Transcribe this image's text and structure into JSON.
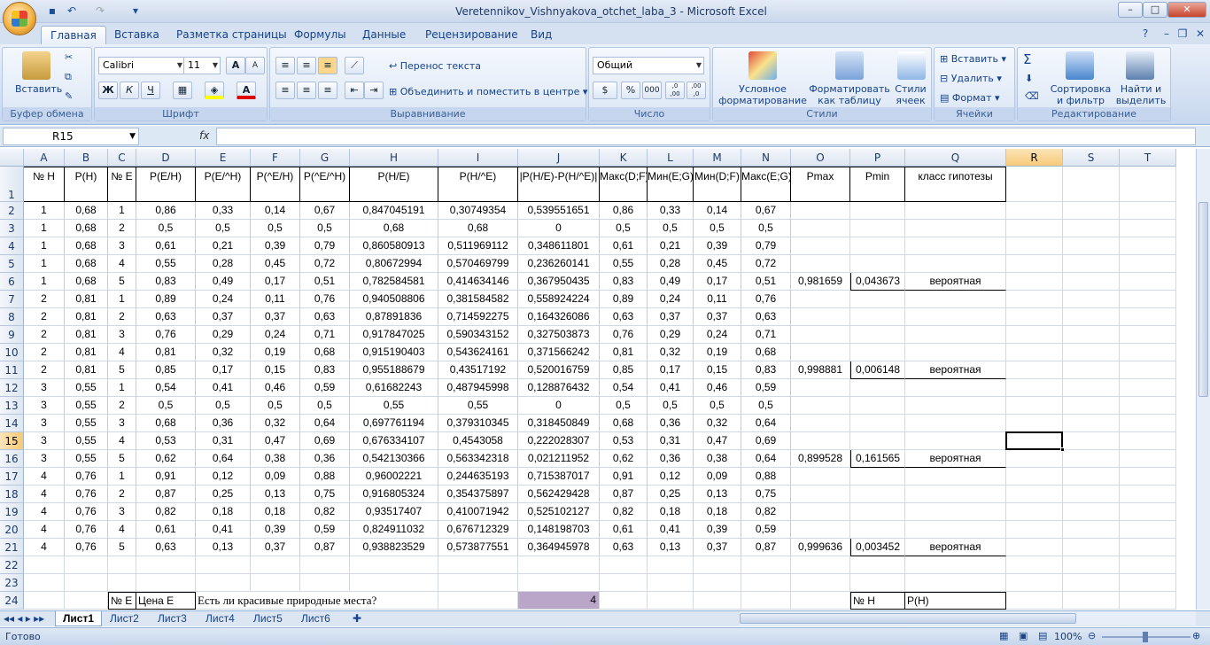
{
  "window": {
    "title": "Veretennikov_Vishnyakova_otchet_laba_3 - Microsoft Excel"
  },
  "tabs": [
    "Главная",
    "Вставка",
    "Разметка страницы",
    "Формулы",
    "Данные",
    "Рецензирование",
    "Вид"
  ],
  "ribbon": {
    "clipboard": {
      "label": "Буфер обмена",
      "paste": "Вставить"
    },
    "font": {
      "label": "Шрифт",
      "name": "Calibri",
      "size": "11",
      "bold": "Ж",
      "italic": "К",
      "underline": "Ч"
    },
    "alignment": {
      "label": "Выравнивание",
      "wrap": "Перенос текста",
      "merge": "Объединить и поместить в центре"
    },
    "number": {
      "label": "Число",
      "format": "Общий",
      "currency": "$",
      "percent": "%",
      "thousands": "000",
      "inc_decimal": ",0 ,00",
      "dec_decimal": ",00 ,0"
    },
    "styles": {
      "label": "Стили",
      "conditional": "Условное форматирование",
      "as_table": "Форматировать как таблицу",
      "cell_styles": "Стили ячеек"
    },
    "cells": {
      "label": "Ячейки",
      "insert": "Вставить",
      "delete": "Удалить",
      "format": "Формат"
    },
    "editing": {
      "label": "Редактирование",
      "sort": "Сортировка и фильтр",
      "find": "Найти и выделить",
      "sum": "Σ"
    }
  },
  "formula_bar": {
    "name_box": "R15",
    "fx": "fx",
    "value": ""
  },
  "columns": [
    "A",
    "B",
    "C",
    "D",
    "E",
    "F",
    "G",
    "H",
    "I",
    "J",
    "K",
    "L",
    "M",
    "N",
    "O",
    "P",
    "Q",
    "R",
    "S",
    "T"
  ],
  "header_row": [
    "№ Н",
    "Р(Н)",
    "№ Е",
    "Р(Е/Н)",
    "Р(Е/^Н)",
    "Р(^Е/Н)",
    "Р(^Е/^Н)",
    "Р(Н/Е)",
    "Р(Н/^Е)",
    "|Р(Н/Е)-Р(Н/^Е)|",
    "Макс(D;F)",
    "Мин(E;G)",
    "Мин(D;F)",
    "Макс(E;G)",
    "Pmax",
    "Pmin",
    "класс гипотезы"
  ],
  "rows": [
    [
      "1",
      "0,68",
      "1",
      "0,86",
      "0,33",
      "0,14",
      "0,67",
      "0,847045191",
      "0,30749354",
      "0,539551651",
      "0,86",
      "0,33",
      "0,14",
      "0,67"
    ],
    [
      "1",
      "0,68",
      "2",
      "0,5",
      "0,5",
      "0,5",
      "0,5",
      "0,68",
      "0,68",
      "0",
      "0,5",
      "0,5",
      "0,5",
      "0,5"
    ],
    [
      "1",
      "0,68",
      "3",
      "0,61",
      "0,21",
      "0,39",
      "0,79",
      "0,860580913",
      "0,511969112",
      "0,348611801",
      "0,61",
      "0,21",
      "0,39",
      "0,79"
    ],
    [
      "1",
      "0,68",
      "4",
      "0,55",
      "0,28",
      "0,45",
      "0,72",
      "0,80672994",
      "0,570469799",
      "0,236260141",
      "0,55",
      "0,28",
      "0,45",
      "0,72"
    ],
    [
      "1",
      "0,68",
      "5",
      "0,83",
      "0,49",
      "0,17",
      "0,51",
      "0,782584581",
      "0,414634146",
      "0,367950435",
      "0,83",
      "0,49",
      "0,17",
      "0,51"
    ],
    [
      "2",
      "0,81",
      "1",
      "0,89",
      "0,24",
      "0,11",
      "0,76",
      "0,940508806",
      "0,381584582",
      "0,558924224",
      "0,89",
      "0,24",
      "0,11",
      "0,76"
    ],
    [
      "2",
      "0,81",
      "2",
      "0,63",
      "0,37",
      "0,37",
      "0,63",
      "0,87891836",
      "0,714592275",
      "0,164326086",
      "0,63",
      "0,37",
      "0,37",
      "0,63"
    ],
    [
      "2",
      "0,81",
      "3",
      "0,76",
      "0,29",
      "0,24",
      "0,71",
      "0,917847025",
      "0,590343152",
      "0,327503873",
      "0,76",
      "0,29",
      "0,24",
      "0,71"
    ],
    [
      "2",
      "0,81",
      "4",
      "0,81",
      "0,32",
      "0,19",
      "0,68",
      "0,915190403",
      "0,543624161",
      "0,371566242",
      "0,81",
      "0,32",
      "0,19",
      "0,68"
    ],
    [
      "2",
      "0,81",
      "5",
      "0,85",
      "0,17",
      "0,15",
      "0,83",
      "0,955188679",
      "0,43517192",
      "0,520016759",
      "0,85",
      "0,17",
      "0,15",
      "0,83"
    ],
    [
      "3",
      "0,55",
      "1",
      "0,54",
      "0,41",
      "0,46",
      "0,59",
      "0,61682243",
      "0,487945998",
      "0,128876432",
      "0,54",
      "0,41",
      "0,46",
      "0,59"
    ],
    [
      "3",
      "0,55",
      "2",
      "0,5",
      "0,5",
      "0,5",
      "0,5",
      "0,55",
      "0,55",
      "0",
      "0,5",
      "0,5",
      "0,5",
      "0,5"
    ],
    [
      "3",
      "0,55",
      "3",
      "0,68",
      "0,36",
      "0,32",
      "0,64",
      "0,697761194",
      "0,379310345",
      "0,318450849",
      "0,68",
      "0,36",
      "0,32",
      "0,64"
    ],
    [
      "3",
      "0,55",
      "4",
      "0,53",
      "0,31",
      "0,47",
      "0,69",
      "0,676334107",
      "0,4543058",
      "0,222028307",
      "0,53",
      "0,31",
      "0,47",
      "0,69"
    ],
    [
      "3",
      "0,55",
      "5",
      "0,62",
      "0,64",
      "0,38",
      "0,36",
      "0,542130366",
      "0,563342318",
      "0,021211952",
      "0,62",
      "0,36",
      "0,38",
      "0,64"
    ],
    [
      "4",
      "0,76",
      "1",
      "0,91",
      "0,12",
      "0,09",
      "0,88",
      "0,96002221",
      "0,244635193",
      "0,715387017",
      "0,91",
      "0,12",
      "0,09",
      "0,88"
    ],
    [
      "4",
      "0,76",
      "2",
      "0,87",
      "0,25",
      "0,13",
      "0,75",
      "0,916805324",
      "0,354375897",
      "0,562429428",
      "0,87",
      "0,25",
      "0,13",
      "0,75"
    ],
    [
      "4",
      "0,76",
      "3",
      "0,82",
      "0,18",
      "0,18",
      "0,82",
      "0,93517407",
      "0,410071942",
      "0,525102127",
      "0,82",
      "0,18",
      "0,18",
      "0,82"
    ],
    [
      "4",
      "0,76",
      "4",
      "0,61",
      "0,41",
      "0,39",
      "0,59",
      "0,824911032",
      "0,676712329",
      "0,148198703",
      "0,61",
      "0,41",
      "0,39",
      "0,59"
    ],
    [
      "4",
      "0,76",
      "5",
      "0,63",
      "0,13",
      "0,37",
      "0,87",
      "0,938823529",
      "0,573877551",
      "0,364945978",
      "0,63",
      "0,13",
      "0,37",
      "0,87"
    ]
  ],
  "summary": [
    {
      "row": 6,
      "pmax": "0,981659",
      "pmin": "0,043673",
      "class": "вероятная"
    },
    {
      "row": 11,
      "pmax": "0,998881",
      "pmin": "0,006148",
      "class": "вероятная"
    },
    {
      "row": 16,
      "pmax": "0,899528",
      "pmin": "0,161565",
      "class": "вероятная"
    },
    {
      "row": 21,
      "pmax": "0,999636",
      "pmin": "0,003452",
      "class": "вероятная"
    }
  ],
  "row24": {
    "c": "№ Е",
    "d": "Цена Е",
    "e": "Есть ли красивые природные места?",
    "j": "4",
    "p": "№ Н",
    "q": "Р(Н)"
  },
  "sheets": [
    "Лист1",
    "Лист2",
    "Лист3",
    "Лист4",
    "Лист5",
    "Лист6"
  ],
  "status": {
    "ready": "Готово",
    "zoom": "100%"
  }
}
